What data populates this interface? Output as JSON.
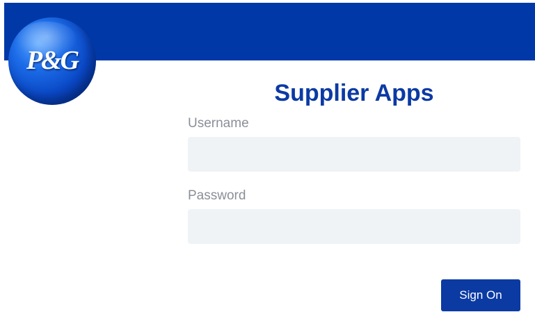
{
  "header": {
    "logo_text": "P&G",
    "bar_color": "#0038a8"
  },
  "form": {
    "title": "Supplier Apps",
    "username_label": "Username",
    "username_value": "",
    "password_label": "Password",
    "password_value": "",
    "submit_label": "Sign On"
  },
  "colors": {
    "brand_blue": "#0b3aa3",
    "label_gray": "#8a8f97",
    "input_background": "#eff3f6"
  },
  "icons": {
    "logo": "pg-logo-icon"
  }
}
